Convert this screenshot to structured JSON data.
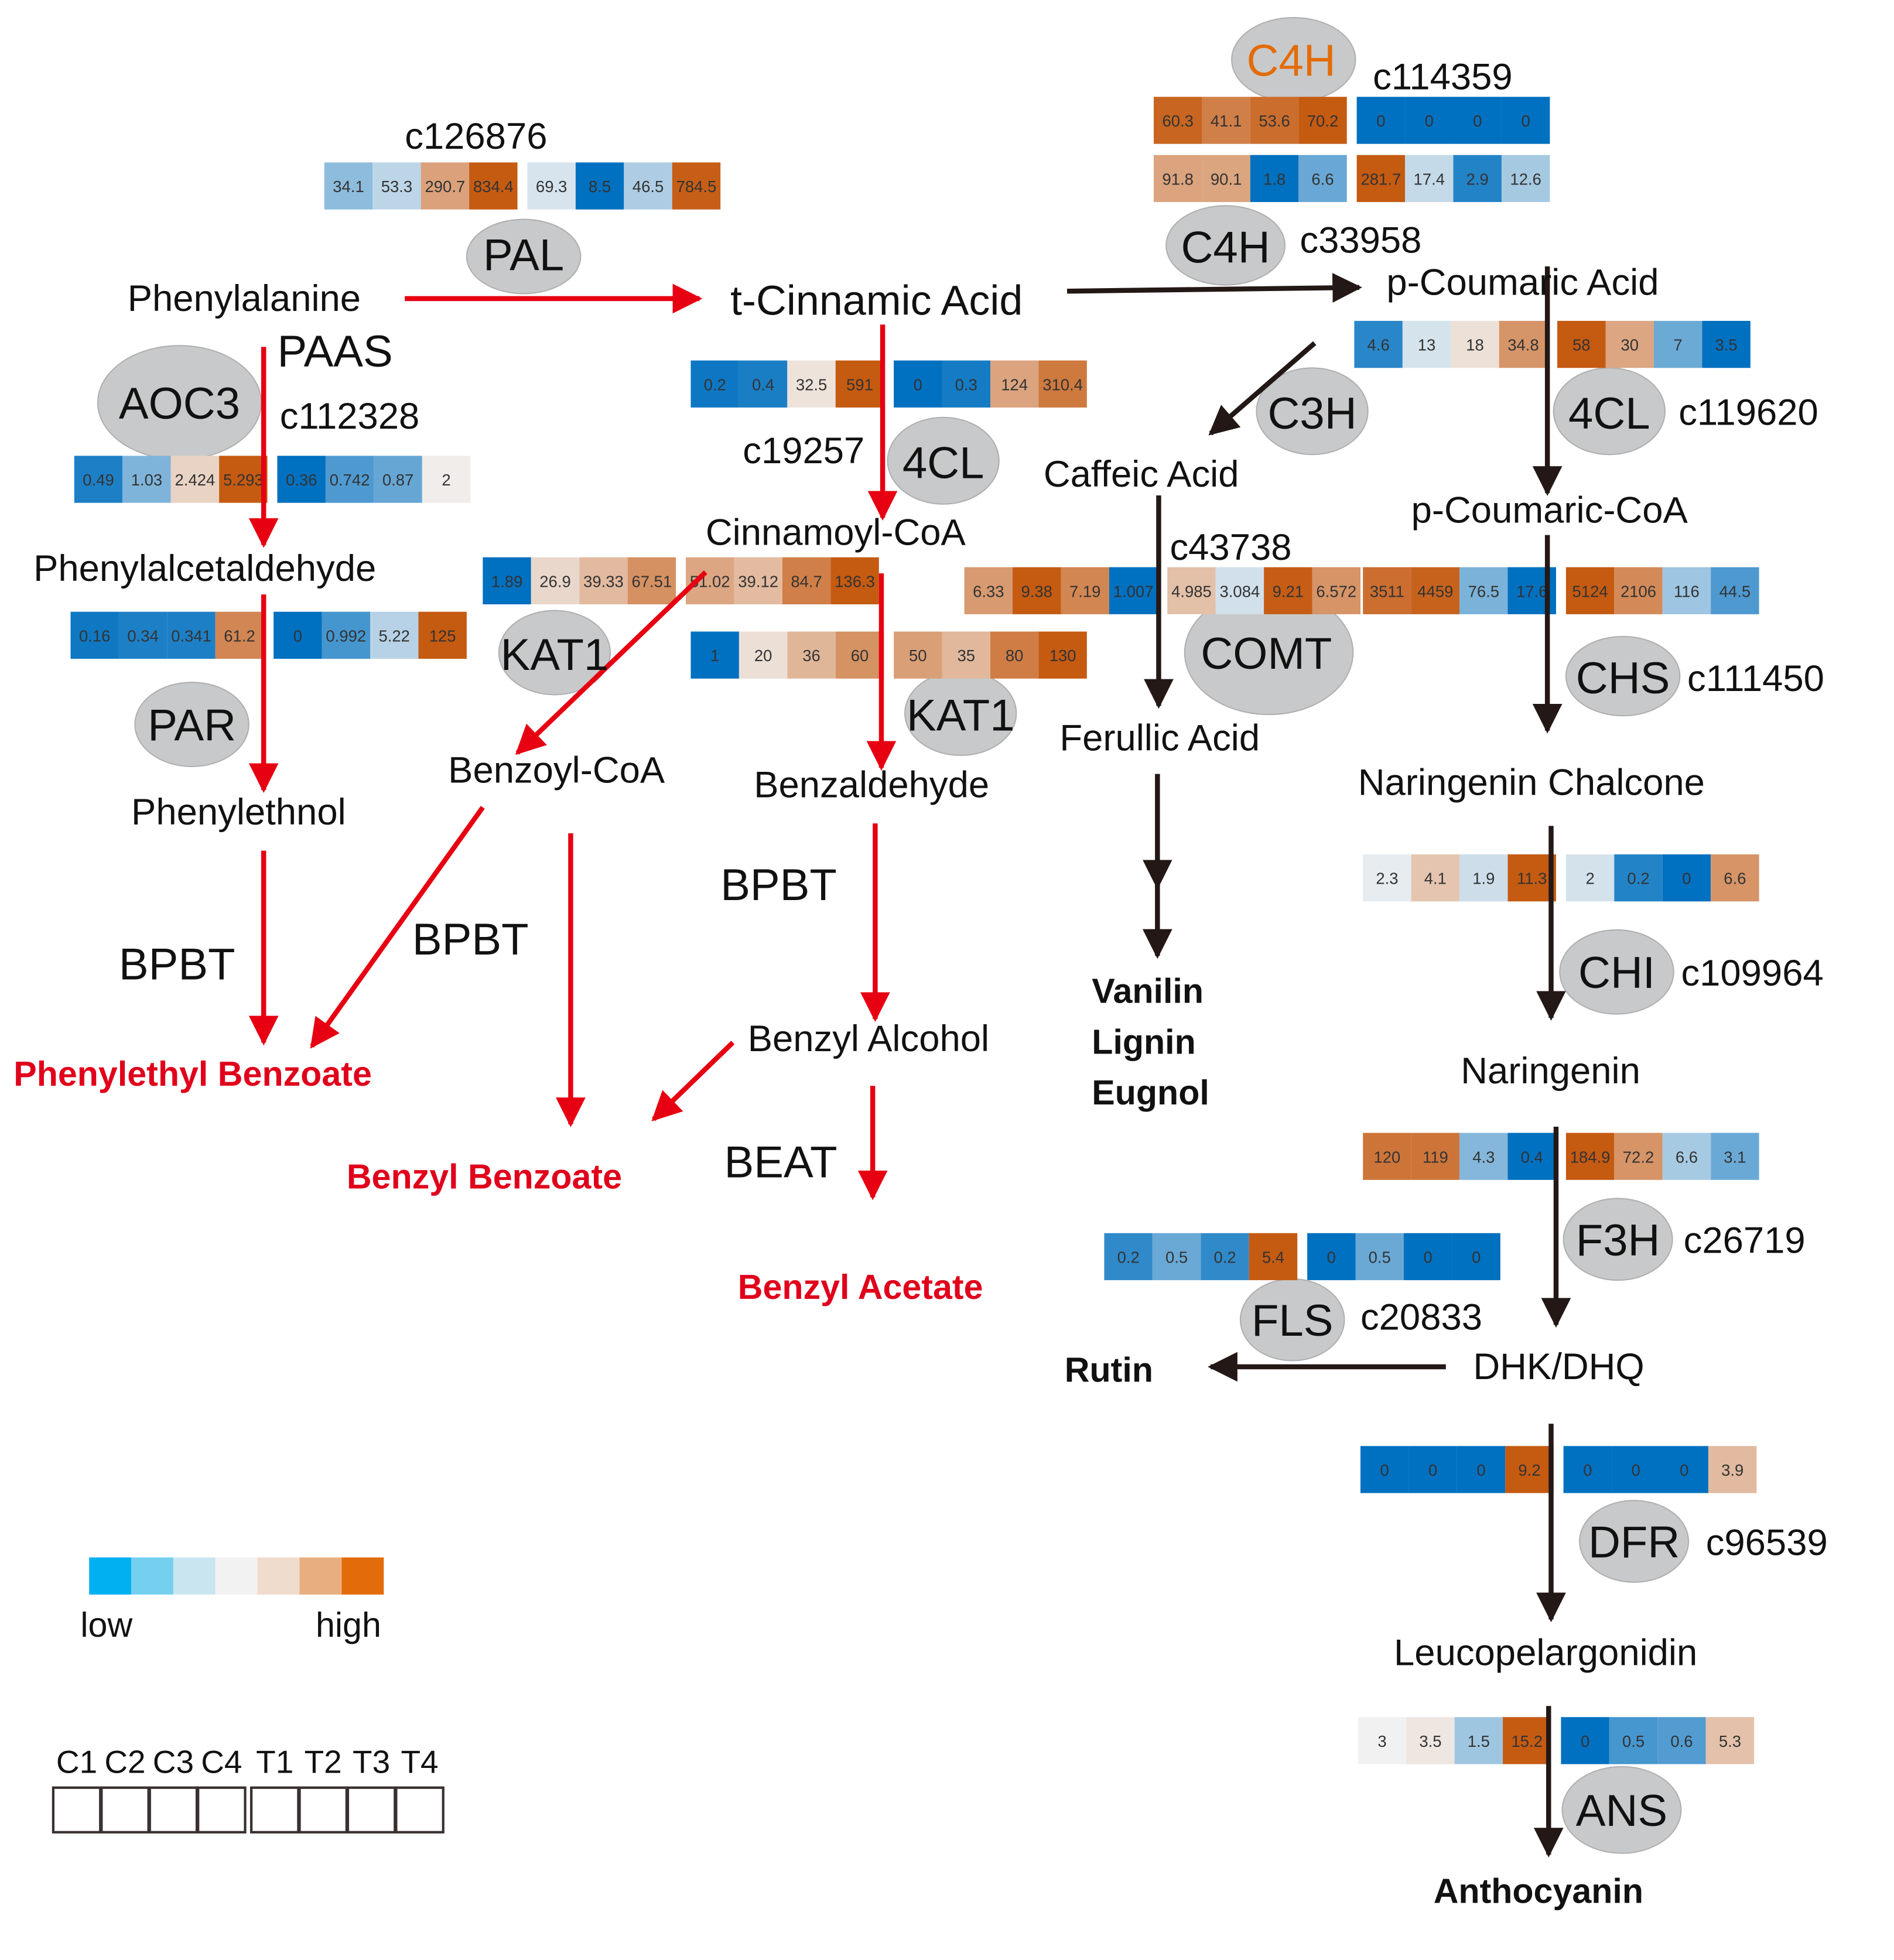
{
  "figure": {
    "type": "pathway-diagram",
    "colors": {
      "red_arrow": "#e60012",
      "black_arrow": "#231815",
      "enzyme_circle": "#c8c9ca",
      "highlight_enzyme": "#e36c09",
      "low": "#0070c0",
      "mid": "#f2f2f2",
      "high": "#c55a11"
    }
  },
  "metabolites": {
    "phenylalanine": "Phenylalanine",
    "t_cinnamic": "t-Cinnamic Acid",
    "p_coumaric_acid": "p-Coumaric Acid",
    "caffeic": "Caffeic Acid",
    "p_coumaric_coa": "p-Coumaric-CoA",
    "cinnamoyl_coa": "Cinnamoyl-CoA",
    "phenylacetaldehyde": "Phenylalcetaldehyde",
    "benzoyl_coa": "Benzoyl-CoA",
    "benzaldehyde": "Benzaldehyde",
    "phenylethnol": "Phenylethnol",
    "ferulic": "Ferullic Acid",
    "naringenin_chalcone": "Naringenin Chalcone",
    "naringenin": "Naringenin",
    "benzyl_alcohol": "Benzyl Alcohol",
    "dhk": "DHK/DHQ",
    "leucopelargonidin": "Leucopelargonidin"
  },
  "products": {
    "phenylethyl_benzoate": "Phenylethyl Benzoate",
    "benzyl_benzoate": "Benzyl Benzoate",
    "benzyl_acetate": "Benzyl Acetate",
    "vanilin": "Vanilin",
    "lignin": "Lignin",
    "eugnol": "Eugnol",
    "rutin": "Rutin",
    "anthocyanin": "Anthocyanin"
  },
  "enzymes": {
    "pal": "PAL",
    "c4h_top": "C4H",
    "c4h": "C4H",
    "paas": "PAAS",
    "aoc3": "AOC3",
    "cl4_left": "4CL",
    "c3h": "C3H",
    "cl4_right": "4CL",
    "kat1_a": "KAT1",
    "kat1_b": "KAT1",
    "comt": "COMT",
    "chs": "CHS",
    "par": "PAR",
    "bpbt_a": "BPBT",
    "bpbt_b": "BPBT",
    "bpbt_c": "BPBT",
    "beat": "BEAT",
    "chi": "CHI",
    "f3h": "F3H",
    "fls": "FLS",
    "dfr": "DFR",
    "ans": "ANS"
  },
  "genes": {
    "pal": "c126876",
    "c4h_top": "c114359",
    "c4h": "c33958",
    "aoc3": "c112328",
    "cl4_left": "c19257",
    "cl4_right": "c119620",
    "comt": "c43738",
    "chs": "c111450",
    "chi": "c109964",
    "f3h": "c26719",
    "fls": "c20833",
    "dfr": "c96539"
  },
  "heatmaps": [
    {
      "id": "pal",
      "values": [
        "34.1",
        "53.3",
        "290.7",
        "834.4",
        "69.3",
        "8.5",
        "46.5",
        "784.5"
      ]
    },
    {
      "id": "c4h_top",
      "values": [
        "60.3",
        "41.1",
        "53.6",
        "70.2",
        "0",
        "0",
        "0",
        "0"
      ]
    },
    {
      "id": "c4h",
      "values": [
        "91.8",
        "90.1",
        "1.8",
        "6.6",
        "281.7",
        "17.4",
        "2.9",
        "12.6"
      ]
    },
    {
      "id": "aoc3",
      "values": [
        "0.49",
        "1.03",
        "2.424",
        "5.293",
        "0.36",
        "0.742",
        "0.87",
        "2"
      ]
    },
    {
      "id": "cl4_left",
      "values": [
        "0.2",
        "0.4",
        "32.5",
        "591",
        "0",
        "0.3",
        "124",
        "310.4"
      ]
    },
    {
      "id": "cl4_right_acid",
      "values": [
        "4.6",
        "13",
        "18",
        "34.8",
        "58",
        "30",
        "7",
        "3.5"
      ]
    },
    {
      "id": "paas",
      "values": [
        "0.16",
        "0.34",
        "0.341",
        "61.2",
        "0",
        "0.992",
        "5.22",
        "125"
      ]
    },
    {
      "id": "kat1_a",
      "values": [
        "1.89",
        "26.9",
        "39.33",
        "67.51",
        "51.02",
        "39.12",
        "84.7",
        "136.3"
      ]
    },
    {
      "id": "kat1_b",
      "values": [
        "1",
        "20",
        "36",
        "60",
        "50",
        "35",
        "80",
        "130"
      ]
    },
    {
      "id": "comt",
      "values": [
        "6.33",
        "9.38",
        "7.19",
        "1.007",
        "4.985",
        "3.084",
        "9.21",
        "6.572"
      ]
    },
    {
      "id": "chs",
      "values": [
        "3511",
        "4459",
        "76.5",
        "17.6",
        "5124",
        "2106",
        "116",
        "44.5"
      ]
    },
    {
      "id": "chi",
      "values": [
        "2.3",
        "4.1",
        "1.9",
        "11.3",
        "2",
        "0.2",
        "0",
        "6.6"
      ]
    },
    {
      "id": "f3h",
      "values": [
        "120",
        "119",
        "4.3",
        "0.4",
        "184.9",
        "72.2",
        "6.6",
        "3.1"
      ]
    },
    {
      "id": "fls",
      "values": [
        "0.2",
        "0.5",
        "0.2",
        "5.4",
        "0",
        "0.5",
        "0",
        "0"
      ]
    },
    {
      "id": "dfr",
      "values": [
        "0",
        "0",
        "0",
        "9.2",
        "0",
        "0",
        "0",
        "3.9"
      ]
    },
    {
      "id": "ans",
      "values": [
        "3",
        "3.5",
        "1.5",
        "15.2",
        "0",
        "0.5",
        "0.6",
        "5.3"
      ]
    }
  ],
  "legend": {
    "scale_colors": [
      "#00b0f0",
      "#75d0f0",
      "#c9e6f0",
      "#f2f2f2",
      "#efdccd",
      "#e8ae80",
      "#e26b0a"
    ],
    "low_label": "low",
    "high_label": "high",
    "samples": [
      "C1",
      "C2",
      "C3",
      "C4",
      "T1",
      "T2",
      "T3",
      "T4"
    ]
  }
}
